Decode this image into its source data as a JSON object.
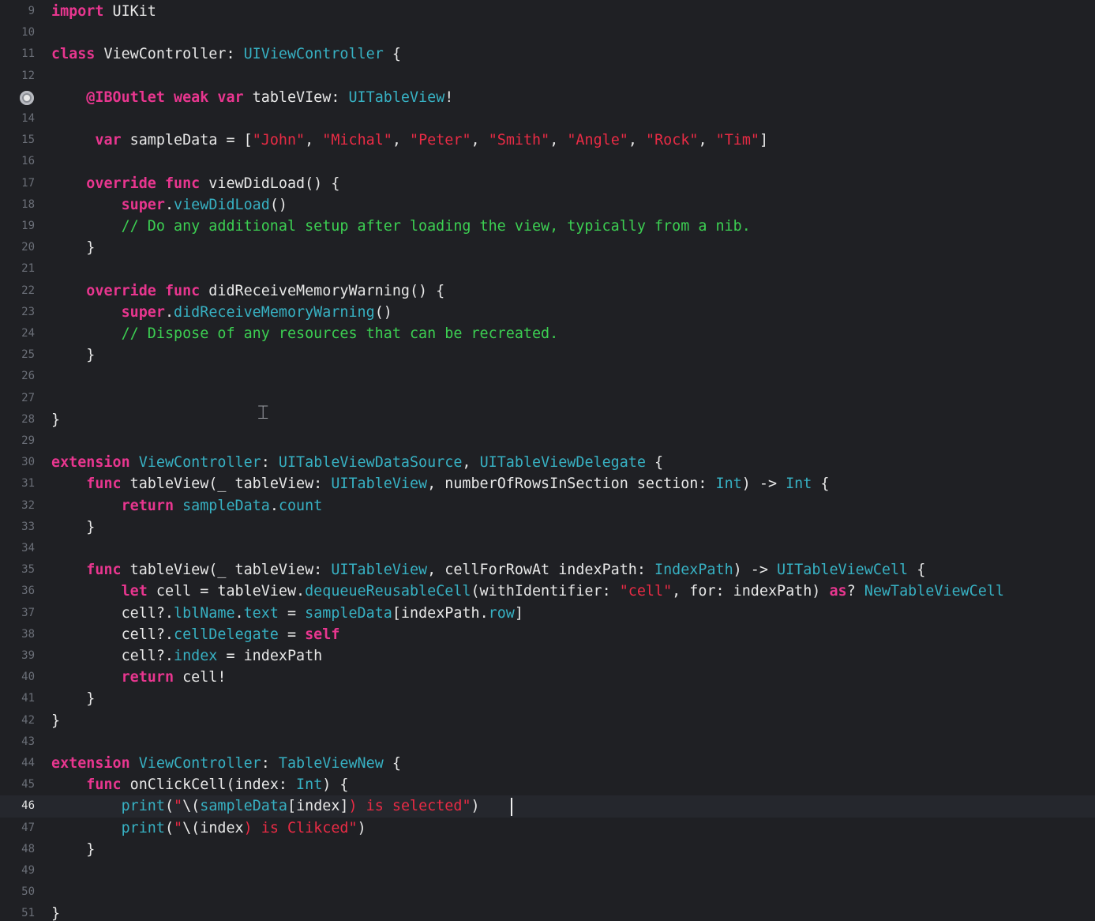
{
  "editor": {
    "current_line": 46,
    "lines": [
      {
        "n": 9,
        "t": [
          [
            "kw",
            "import"
          ],
          [
            "pl",
            " UIKit"
          ]
        ]
      },
      {
        "n": 10,
        "t": []
      },
      {
        "n": 11,
        "t": [
          [
            "kw",
            "class"
          ],
          [
            "pl",
            " ViewController: "
          ],
          [
            "ty",
            "UIViewController"
          ],
          [
            "pl",
            " {"
          ]
        ]
      },
      {
        "n": 12,
        "t": []
      },
      {
        "n": 13,
        "t": [
          [
            "pl",
            "    "
          ],
          [
            "kw",
            "@IBOutlet weak var"
          ],
          [
            "pl",
            " tableVIew: "
          ],
          [
            "ty",
            "UITableView"
          ],
          [
            "pl",
            "!"
          ]
        ],
        "breakpoint": true
      },
      {
        "n": 14,
        "t": []
      },
      {
        "n": 15,
        "t": [
          [
            "pl",
            "     "
          ],
          [
            "kw",
            "var"
          ],
          [
            "pl",
            " sampleData = ["
          ],
          [
            "str",
            "\"John\""
          ],
          [
            "pl",
            ", "
          ],
          [
            "str",
            "\"Michal\""
          ],
          [
            "pl",
            ", "
          ],
          [
            "str",
            "\"Peter\""
          ],
          [
            "pl",
            ", "
          ],
          [
            "str",
            "\"Smith\""
          ],
          [
            "pl",
            ", "
          ],
          [
            "str",
            "\"Angle\""
          ],
          [
            "pl",
            ", "
          ],
          [
            "str",
            "\"Rock\""
          ],
          [
            "pl",
            ", "
          ],
          [
            "str",
            "\"Tim\""
          ],
          [
            "pl",
            "]"
          ]
        ]
      },
      {
        "n": 16,
        "t": []
      },
      {
        "n": 17,
        "t": [
          [
            "pl",
            "    "
          ],
          [
            "kw",
            "override func"
          ],
          [
            "pl",
            " viewDidLoad() {"
          ]
        ]
      },
      {
        "n": 18,
        "t": [
          [
            "pl",
            "        "
          ],
          [
            "kw",
            "super"
          ],
          [
            "pl",
            "."
          ],
          [
            "fn",
            "viewDidLoad"
          ],
          [
            "pl",
            "()"
          ]
        ]
      },
      {
        "n": 19,
        "t": [
          [
            "pl",
            "        "
          ],
          [
            "cm",
            "// Do any additional setup after loading the view, typically from a nib."
          ]
        ]
      },
      {
        "n": 20,
        "t": [
          [
            "pl",
            "    }"
          ]
        ]
      },
      {
        "n": 21,
        "t": []
      },
      {
        "n": 22,
        "t": [
          [
            "pl",
            "    "
          ],
          [
            "kw",
            "override func"
          ],
          [
            "pl",
            " didReceiveMemoryWarning() {"
          ]
        ]
      },
      {
        "n": 23,
        "t": [
          [
            "pl",
            "        "
          ],
          [
            "kw",
            "super"
          ],
          [
            "pl",
            "."
          ],
          [
            "fn",
            "didReceiveMemoryWarning"
          ],
          [
            "pl",
            "()"
          ]
        ]
      },
      {
        "n": 24,
        "t": [
          [
            "pl",
            "        "
          ],
          [
            "cm",
            "// Dispose of any resources that can be recreated."
          ]
        ]
      },
      {
        "n": 25,
        "t": [
          [
            "pl",
            "    }"
          ]
        ]
      },
      {
        "n": 26,
        "t": []
      },
      {
        "n": 27,
        "t": []
      },
      {
        "n": 28,
        "t": [
          [
            "pl",
            "}"
          ]
        ]
      },
      {
        "n": 29,
        "t": []
      },
      {
        "n": 30,
        "t": [
          [
            "kw",
            "extension"
          ],
          [
            "pl",
            " "
          ],
          [
            "ty",
            "ViewController"
          ],
          [
            "pl",
            ": "
          ],
          [
            "ty",
            "UITableViewDataSource"
          ],
          [
            "pl",
            ", "
          ],
          [
            "ty",
            "UITableViewDelegate"
          ],
          [
            "pl",
            " {"
          ]
        ]
      },
      {
        "n": 31,
        "t": [
          [
            "pl",
            "    "
          ],
          [
            "kw",
            "func"
          ],
          [
            "pl",
            " tableView(_ tableView: "
          ],
          [
            "ty",
            "UITableView"
          ],
          [
            "pl",
            ", numberOfRowsInSection section: "
          ],
          [
            "ty",
            "Int"
          ],
          [
            "pl",
            ") -> "
          ],
          [
            "ty",
            "Int"
          ],
          [
            "pl",
            " {"
          ]
        ]
      },
      {
        "n": 32,
        "t": [
          [
            "pl",
            "        "
          ],
          [
            "kw",
            "return"
          ],
          [
            "pl",
            " "
          ],
          [
            "fn",
            "sampleData"
          ],
          [
            "pl",
            "."
          ],
          [
            "fn",
            "count"
          ]
        ]
      },
      {
        "n": 33,
        "t": [
          [
            "pl",
            "    }"
          ]
        ]
      },
      {
        "n": 34,
        "t": []
      },
      {
        "n": 35,
        "t": [
          [
            "pl",
            "    "
          ],
          [
            "kw",
            "func"
          ],
          [
            "pl",
            " tableView(_ tableView: "
          ],
          [
            "ty",
            "UITableView"
          ],
          [
            "pl",
            ", cellForRowAt indexPath: "
          ],
          [
            "ty",
            "IndexPath"
          ],
          [
            "pl",
            ") -> "
          ],
          [
            "ty",
            "UITableViewCell"
          ],
          [
            "pl",
            " {"
          ]
        ]
      },
      {
        "n": 36,
        "t": [
          [
            "pl",
            "        "
          ],
          [
            "kw",
            "let"
          ],
          [
            "pl",
            " cell = tableView."
          ],
          [
            "fn",
            "dequeueReusableCell"
          ],
          [
            "pl",
            "(withIdentifier: "
          ],
          [
            "str",
            "\"cell\""
          ],
          [
            "pl",
            ", for: indexPath) "
          ],
          [
            "kw",
            "as"
          ],
          [
            "pl",
            "? "
          ],
          [
            "ty",
            "NewTableViewCell"
          ]
        ]
      },
      {
        "n": 37,
        "t": [
          [
            "pl",
            "        cell?."
          ],
          [
            "fn",
            "lblName"
          ],
          [
            "pl",
            "."
          ],
          [
            "fn",
            "text"
          ],
          [
            "pl",
            " = "
          ],
          [
            "fn",
            "sampleData"
          ],
          [
            "pl",
            "[indexPath."
          ],
          [
            "fn",
            "row"
          ],
          [
            "pl",
            "]"
          ]
        ]
      },
      {
        "n": 38,
        "t": [
          [
            "pl",
            "        cell?."
          ],
          [
            "fn",
            "cellDelegate"
          ],
          [
            "pl",
            " = "
          ],
          [
            "kw",
            "self"
          ]
        ]
      },
      {
        "n": 39,
        "t": [
          [
            "pl",
            "        cell?."
          ],
          [
            "fn",
            "index"
          ],
          [
            "pl",
            " = indexPath"
          ]
        ]
      },
      {
        "n": 40,
        "t": [
          [
            "pl",
            "        "
          ],
          [
            "kw",
            "return"
          ],
          [
            "pl",
            " cell!"
          ]
        ]
      },
      {
        "n": 41,
        "t": [
          [
            "pl",
            "    }"
          ]
        ]
      },
      {
        "n": 42,
        "t": [
          [
            "pl",
            "}"
          ]
        ]
      },
      {
        "n": 43,
        "t": []
      },
      {
        "n": 44,
        "t": [
          [
            "kw",
            "extension"
          ],
          [
            "pl",
            " "
          ],
          [
            "ty",
            "ViewController"
          ],
          [
            "pl",
            ": "
          ],
          [
            "ty",
            "TableViewNew"
          ],
          [
            "pl",
            " {"
          ]
        ]
      },
      {
        "n": 45,
        "t": [
          [
            "pl",
            "    "
          ],
          [
            "kw",
            "func"
          ],
          [
            "pl",
            " onClickCell(index: "
          ],
          [
            "ty",
            "Int"
          ],
          [
            "pl",
            ") {"
          ]
        ]
      },
      {
        "n": 46,
        "t": [
          [
            "pl",
            "        "
          ],
          [
            "fn",
            "print"
          ],
          [
            "pl",
            "("
          ],
          [
            "str",
            "\""
          ],
          [
            "pl",
            "\\("
          ],
          [
            "fn",
            "sampleData"
          ],
          [
            "pl",
            "[index]"
          ],
          [
            "str",
            ") is selected\""
          ],
          [
            "pl",
            ")"
          ]
        ]
      },
      {
        "n": 47,
        "t": [
          [
            "pl",
            "        "
          ],
          [
            "fn",
            "print"
          ],
          [
            "pl",
            "("
          ],
          [
            "str",
            "\""
          ],
          [
            "pl",
            "\\("
          ],
          [
            "pl",
            "index"
          ],
          [
            "str",
            ") is Clikced\""
          ],
          [
            "pl",
            ")"
          ]
        ]
      },
      {
        "n": 48,
        "t": [
          [
            "pl",
            "    }"
          ]
        ]
      },
      {
        "n": 49,
        "t": []
      },
      {
        "n": 50,
        "t": []
      },
      {
        "n": 51,
        "t": [
          [
            "pl",
            "}"
          ]
        ]
      }
    ]
  }
}
